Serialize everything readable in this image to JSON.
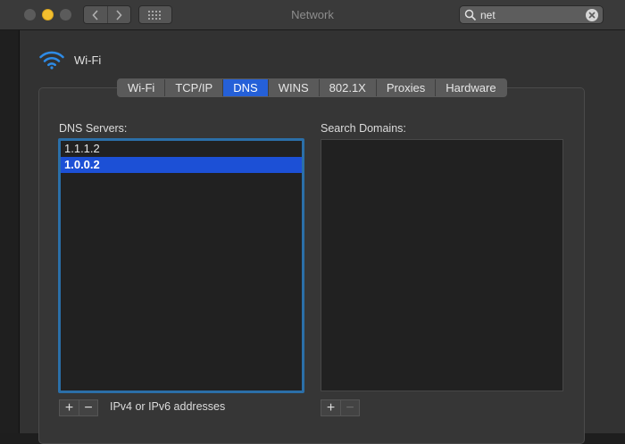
{
  "window": {
    "title": "Network"
  },
  "search": {
    "value": "net"
  },
  "header": {
    "interface_label": "Wi-Fi"
  },
  "tabs": [
    {
      "label": "Wi-Fi",
      "active": false
    },
    {
      "label": "TCP/IP",
      "active": false
    },
    {
      "label": "DNS",
      "active": true
    },
    {
      "label": "WINS",
      "active": false
    },
    {
      "label": "802.1X",
      "active": false
    },
    {
      "label": "Proxies",
      "active": false
    },
    {
      "label": "Hardware",
      "active": false
    }
  ],
  "dns": {
    "label": "DNS Servers:",
    "servers": [
      "1.1.1.2",
      "1.0.0.2"
    ],
    "selected_index": 1,
    "add_label": "+",
    "remove_label": "−",
    "hint": "IPv4 or IPv6 addresses"
  },
  "domains": {
    "label": "Search Domains:",
    "items": [],
    "add_label": "+",
    "remove_label": "−"
  },
  "colors": {
    "accent": "#2560d8",
    "selection": "#1c50d6",
    "focus_ring": "#2b6fa8",
    "minimize": "#f3bf2f"
  }
}
